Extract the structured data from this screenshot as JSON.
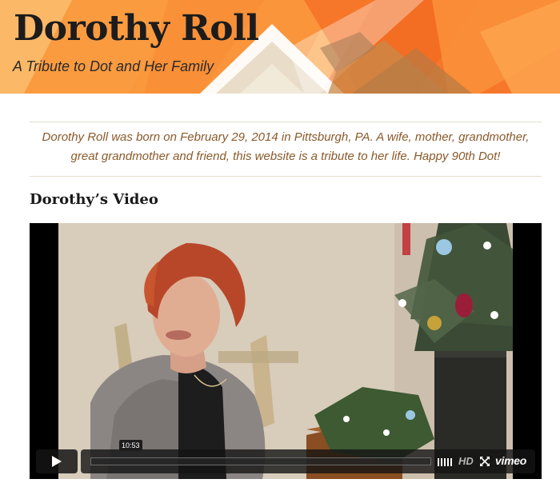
{
  "header": {
    "title": "Dorothy Roll",
    "tagline": "A Tribute to Dot and Her Family"
  },
  "intro": {
    "text": "Dorothy Roll was born on February 29, 2014 in Pittsburgh, PA.  A wife, mother, grandmother, great grandmother and friend, this website is a tribute to her life.  Happy 90th Dot!"
  },
  "section": {
    "title": "Dorothy’s Video"
  },
  "video": {
    "time": "10:53",
    "progress": 0,
    "hd_label": "HD",
    "provider": "vimeo"
  },
  "colors": {
    "banner_orange": "#fca64a",
    "banner_deep_orange": "#f6772a",
    "intro_text": "#8a5a2b",
    "progress_accent": "#00adef"
  }
}
